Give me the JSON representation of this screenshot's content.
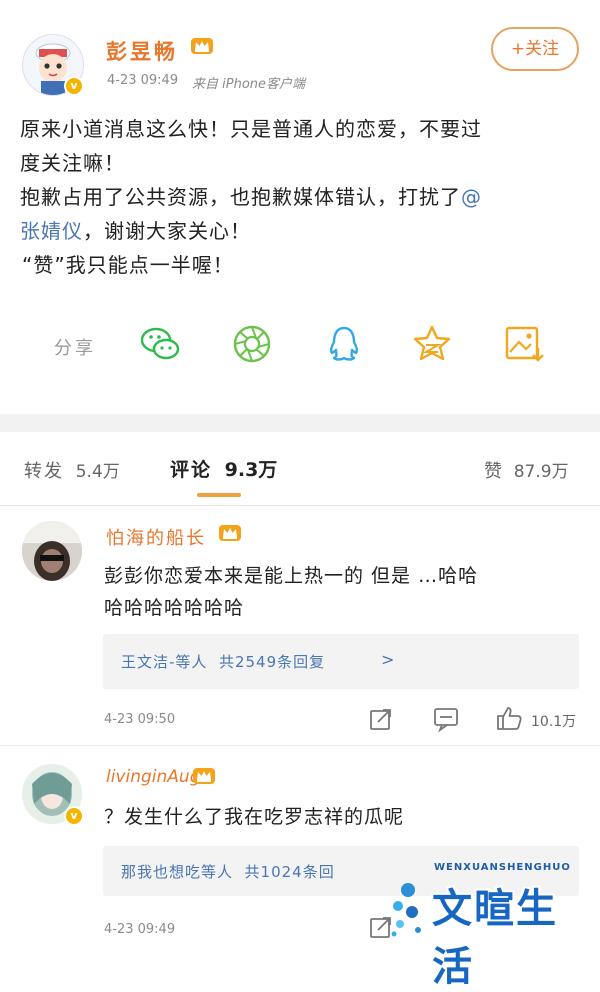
{
  "post": {
    "author": "彭昱畅",
    "meta_time": "4-23 09:49",
    "meta_source": "来自 iPhone客户端",
    "follow_label": "+关注",
    "lines": [
      "原来小道消息这么快！只是普通人的恋爱，不要过",
      "度关注嘛！",
      "抱歉占用了公共资源，也抱歉媒体错认，打扰了",
      "谢谢大家关心！",
      "“赞”我只能点一半喔！"
    ],
    "mention_a": "@",
    "mention_b": "张婧仪",
    "mention_sep": "，"
  },
  "share": {
    "label": "分享",
    "icons": [
      "wechat-icon",
      "moments-icon",
      "qq-icon",
      "qzone-icon",
      "save-image-icon"
    ]
  },
  "tabs": {
    "repost_label": "转发",
    "repost_count": "5.4万",
    "comment_label": "评论",
    "comment_count": "9.3万",
    "like_label": "赞",
    "like_count": "87.9万"
  },
  "comments": [
    {
      "user": "怕海的船长",
      "lines": [
        "彭彭你恋爱本来是能上热一的 但是 …哈哈",
        "哈哈哈哈哈哈哈"
      ],
      "reply_text": "王文洁-等人  共2549条回复",
      "reply_arrow": ">",
      "time": "4-23 09:50",
      "likes": "10.1万"
    },
    {
      "user": "livinginAug",
      "lines": [
        "？发生什么了我在吃罗志祥的瓜呢"
      ],
      "reply_text": "那我也想吃等人  共1024条回",
      "time": "4-23 09:49"
    }
  ],
  "watermark": {
    "top": "WENXUANSHENGHUO",
    "main": "文暄生活"
  },
  "colors": {
    "accent": "#e8772d",
    "link": "#4a76b3",
    "badge": "#f4b400",
    "band": "#f2f2f2"
  }
}
